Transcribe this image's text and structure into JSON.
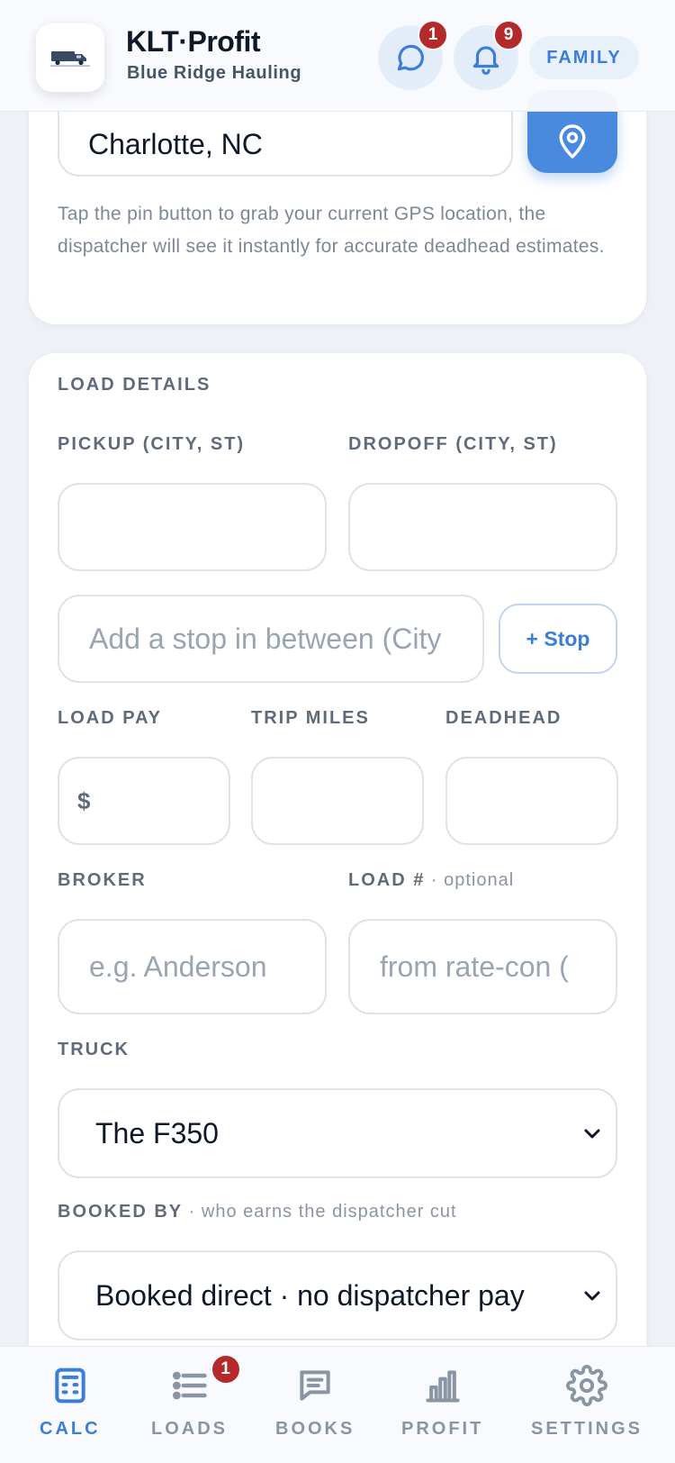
{
  "header": {
    "app_title": "KLT·Profit",
    "app_subtitle": "Blue Ridge Hauling",
    "messages_badge": "1",
    "notifications_badge": "9",
    "family_label": "FAMILY"
  },
  "location": {
    "value": "Charlotte, NC",
    "hint": "Tap the pin button to grab your current GPS location, the dispatcher will see it instantly for accurate deadhead estimates."
  },
  "load_details": {
    "section_title": "LOAD DETAILS",
    "pickup_label": "PICKUP (CITY, ST)",
    "pickup_value": "",
    "dropoff_label": "DROPOFF (CITY, ST)",
    "dropoff_value": "",
    "stop_placeholder": "Add a stop in between (City",
    "stop_button": "+ Stop",
    "load_pay_label": "LOAD PAY",
    "load_pay_prefix": "$",
    "trip_miles_label": "TRIP MILES",
    "deadhead_label": "DEADHEAD",
    "broker_label": "BROKER",
    "broker_placeholder": "e.g. Anderson",
    "load_num_label": "LOAD #",
    "load_num_optional": " · optional",
    "load_num_placeholder": "from rate-con (",
    "truck_label": "TRUCK",
    "truck_value": "The F350",
    "booked_by_label": "BOOKED BY",
    "booked_by_note": " · who earns the dispatcher cut",
    "booked_by_value": "Booked direct · no dispatcher pay"
  },
  "nav": {
    "items": [
      {
        "label": "CALC",
        "icon": "calculator-icon",
        "active": true
      },
      {
        "label": "LOADS",
        "icon": "list-icon",
        "badge": "1"
      },
      {
        "label": "BOOKS",
        "icon": "message-square-icon"
      },
      {
        "label": "PROFIT",
        "icon": "bar-chart-icon"
      },
      {
        "label": "SETTINGS",
        "icon": "gear-icon"
      }
    ]
  },
  "colors": {
    "accent": "#3b7dd8",
    "pin_button": "#4a8ade",
    "badge": "#b42a2a",
    "background": "#eef2f7"
  }
}
